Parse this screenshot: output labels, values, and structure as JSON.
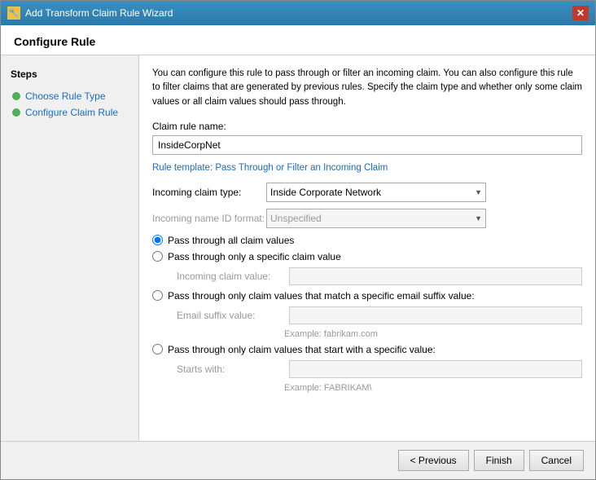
{
  "window": {
    "title": "Add Transform Claim Rule Wizard",
    "icon": "🔧",
    "close_label": "✕"
  },
  "page_title": "Configure Rule",
  "sidebar": {
    "title": "Steps",
    "items": [
      {
        "id": "choose-rule-type",
        "label": "Choose Rule Type",
        "done": true
      },
      {
        "id": "configure-claim-rule",
        "label": "Configure Claim Rule",
        "done": true,
        "active": true
      }
    ]
  },
  "description": "You can configure this rule to pass through or filter an incoming claim. You can also configure this rule to filter claims that are generated by previous rules. Specify the claim type and whether only some claim values or all claim values should pass through.",
  "form": {
    "claim_rule_name_label": "Claim rule name:",
    "claim_rule_name_value": "InsideCorpNet",
    "rule_template_text": "Rule template: Pass Through or Filter an Incoming Claim",
    "incoming_claim_type_label": "Incoming claim type:",
    "incoming_claim_type_value": "Inside Corporate Network",
    "incoming_name_id_format_label": "Incoming name ID format:",
    "incoming_name_id_format_value": "Unspecified",
    "radio_options": [
      {
        "id": "pass-all",
        "label": "Pass through all claim values",
        "checked": true
      },
      {
        "id": "pass-specific",
        "label": "Pass through only a specific claim value",
        "checked": false
      },
      {
        "id": "pass-email",
        "label": "Pass through only claim values that match a specific email suffix value:",
        "checked": false
      },
      {
        "id": "pass-starts",
        "label": "Pass through only claim values that start with a specific value:",
        "checked": false
      }
    ],
    "incoming_claim_value_label": "Incoming claim value:",
    "email_suffix_label": "Email suffix value:",
    "email_example": "Example: fabrikam.com",
    "starts_with_label": "Starts with:",
    "starts_with_example": "Example: FABRIKAM\\"
  },
  "footer": {
    "previous_label": "< Previous",
    "finish_label": "Finish",
    "cancel_label": "Cancel"
  }
}
